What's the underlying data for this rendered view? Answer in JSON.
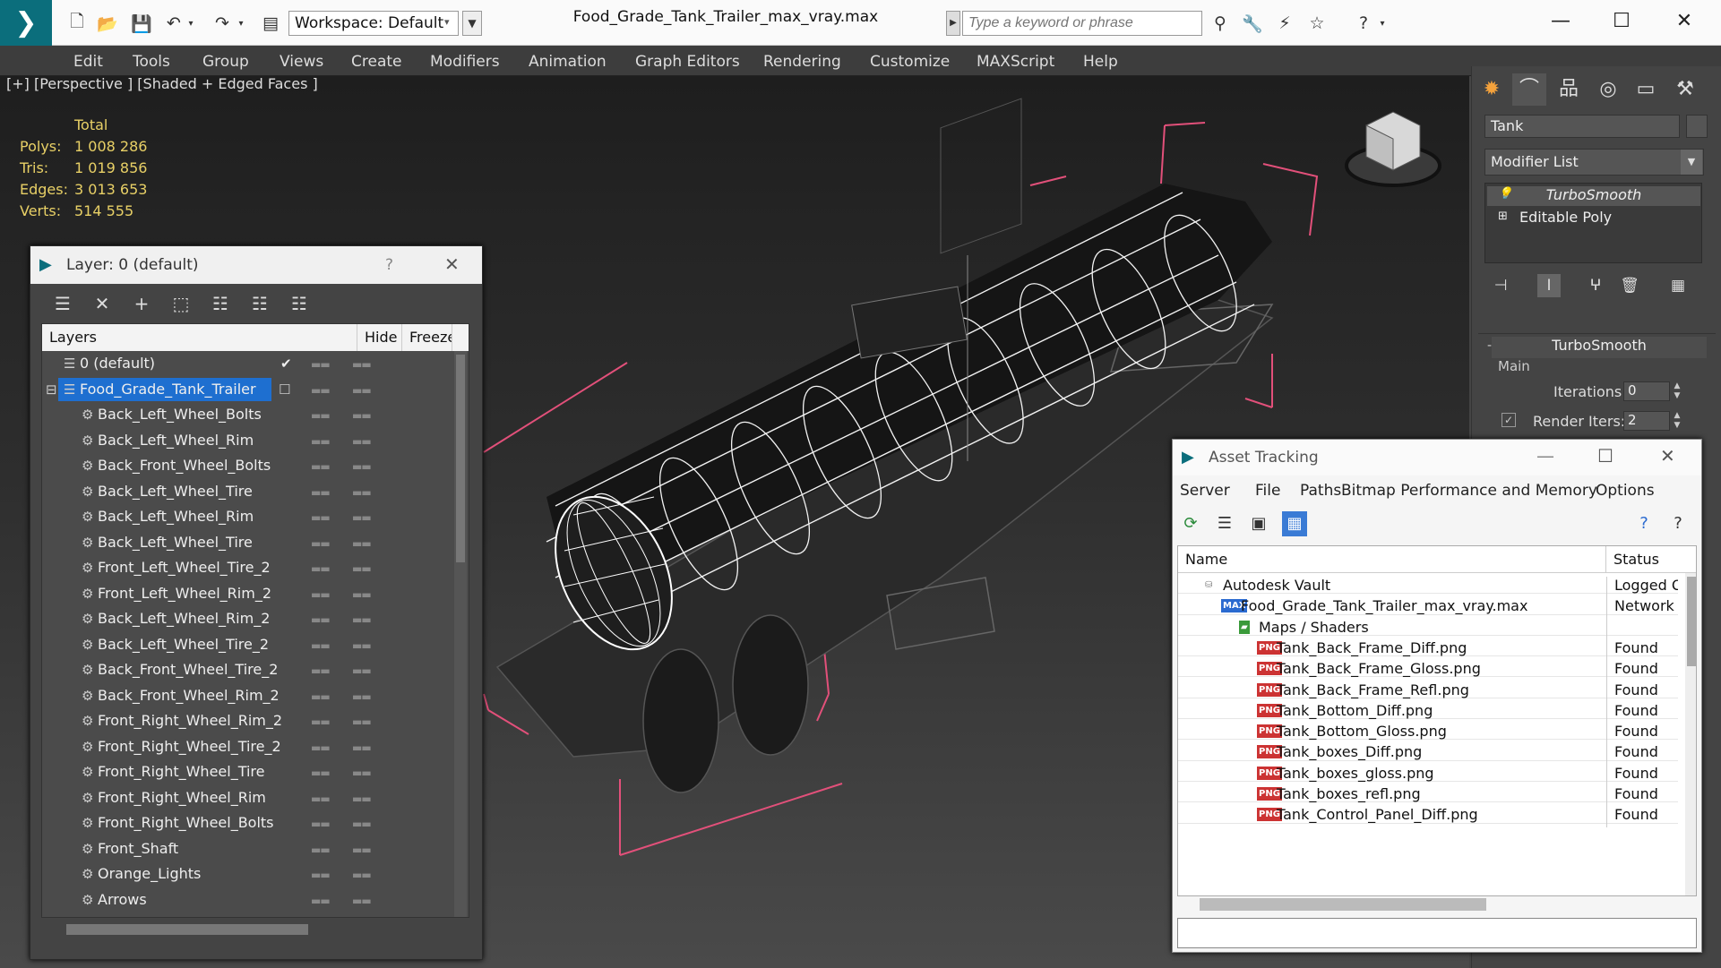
{
  "titlebar": {
    "workspace": "Workspace: Default",
    "filename": "Food_Grade_Tank_Trailer_max_vray.max",
    "search_placeholder": "Type a keyword or phrase"
  },
  "menu": [
    "Edit",
    "Tools",
    "Group",
    "Views",
    "Create",
    "Modifiers",
    "Animation",
    "Graph Editors",
    "Rendering",
    "Customize",
    "MAXScript",
    "Help"
  ],
  "viewport": {
    "label": "[+] [Perspective ] [Shaded + Edged Faces ]",
    "stats_header": "Total",
    "stats": [
      {
        "k": "Polys:",
        "v": "1 008 286"
      },
      {
        "k": "Tris:",
        "v": "1 019 856"
      },
      {
        "k": "Edges:",
        "v": "3 013 653"
      },
      {
        "k": "Verts:",
        "v": "514 555"
      }
    ]
  },
  "command_panel": {
    "object_name": "Tank",
    "modifier_list": "Modifier List",
    "stack": [
      "TurboSmooth",
      "Editable Poly"
    ],
    "rollout_title": "TurboSmooth",
    "group_main": "Main",
    "iterations_label": "Iterations:",
    "iterations_value": "0",
    "render_iters_label": "Render Iters:",
    "render_iters_value": "2"
  },
  "layer_dialog": {
    "title": "Layer: 0 (default)",
    "help": "?",
    "col_layers": "Layers",
    "col_hide": "Hide",
    "col_freeze": "Freeze",
    "layers": [
      {
        "name": "0 (default)",
        "level": 0,
        "current": true
      },
      {
        "name": "Food_Grade_Tank_Trailer",
        "level": 0,
        "selected": true
      },
      {
        "name": "Back_Left_Wheel_Bolts",
        "level": 1
      },
      {
        "name": "Back_Left_Wheel_Rim",
        "level": 1
      },
      {
        "name": "Back_Front_Wheel_Bolts",
        "level": 1
      },
      {
        "name": "Back_Left_Wheel_Tire",
        "level": 1
      },
      {
        "name": "Back_Left_Wheel_Rim",
        "level": 1
      },
      {
        "name": "Back_Left_Wheel_Tire",
        "level": 1
      },
      {
        "name": "Front_Left_Wheel_Tire_2",
        "level": 1
      },
      {
        "name": "Front_Left_Wheel_Rim_2",
        "level": 1
      },
      {
        "name": "Back_Left_Wheel_Rim_2",
        "level": 1
      },
      {
        "name": "Back_Left_Wheel_Tire_2",
        "level": 1
      },
      {
        "name": "Back_Front_Wheel_Tire_2",
        "level": 1
      },
      {
        "name": "Back_Front_Wheel_Rim_2",
        "level": 1
      },
      {
        "name": "Front_Right_Wheel_Rim_2",
        "level": 1
      },
      {
        "name": "Front_Right_Wheel_Tire_2",
        "level": 1
      },
      {
        "name": "Front_Right_Wheel_Tire",
        "level": 1
      },
      {
        "name": "Front_Right_Wheel_Rim",
        "level": 1
      },
      {
        "name": "Front_Right_Wheel_Bolts",
        "level": 1
      },
      {
        "name": "Front_Shaft",
        "level": 1
      },
      {
        "name": "Orange_Lights",
        "level": 1
      },
      {
        "name": "Arrows",
        "level": 1
      }
    ]
  },
  "asset_dialog": {
    "title": "Asset Tracking",
    "menu": [
      "Server",
      "File",
      "Paths",
      "Bitmap Performance and Memory",
      "Options"
    ],
    "col_name": "Name",
    "col_status": "Status",
    "rows": [
      {
        "name": "Autodesk Vault",
        "status": "Logged Out",
        "indent": 50,
        "type": "vault"
      },
      {
        "name": "Food_Grade_Tank_Trailer_max_vray.max",
        "status": "Network",
        "indent": 70,
        "type": "max"
      },
      {
        "name": "Maps / Shaders",
        "status": "",
        "indent": 90,
        "type": "folder"
      },
      {
        "name": "Tank_Back_Frame_Diff.png",
        "status": "Found",
        "indent": 110,
        "type": "png"
      },
      {
        "name": "Tank_Back_Frame_Gloss.png",
        "status": "Found",
        "indent": 110,
        "type": "png"
      },
      {
        "name": "Tank_Back_Frame_Refl.png",
        "status": "Found",
        "indent": 110,
        "type": "png"
      },
      {
        "name": "Tank_Bottom_Diff.png",
        "status": "Found",
        "indent": 110,
        "type": "png"
      },
      {
        "name": "Tank_Bottom_Gloss.png",
        "status": "Found",
        "indent": 110,
        "type": "png"
      },
      {
        "name": "Tank_boxes_Diff.png",
        "status": "Found",
        "indent": 110,
        "type": "png"
      },
      {
        "name": "Tank_boxes_gloss.png",
        "status": "Found",
        "indent": 110,
        "type": "png"
      },
      {
        "name": "Tank_boxes_refl.png",
        "status": "Found",
        "indent": 110,
        "type": "png"
      },
      {
        "name": "Tank_Control_Panel_Diff.png",
        "status": "Found",
        "indent": 110,
        "type": "png"
      }
    ]
  },
  "colors": {
    "selection": "#1e6fd0",
    "stats": "#e8d066",
    "bbox": "#e2507a",
    "logo": "#0b6e7c"
  },
  "icons": {
    "png_badge": "PNG"
  }
}
